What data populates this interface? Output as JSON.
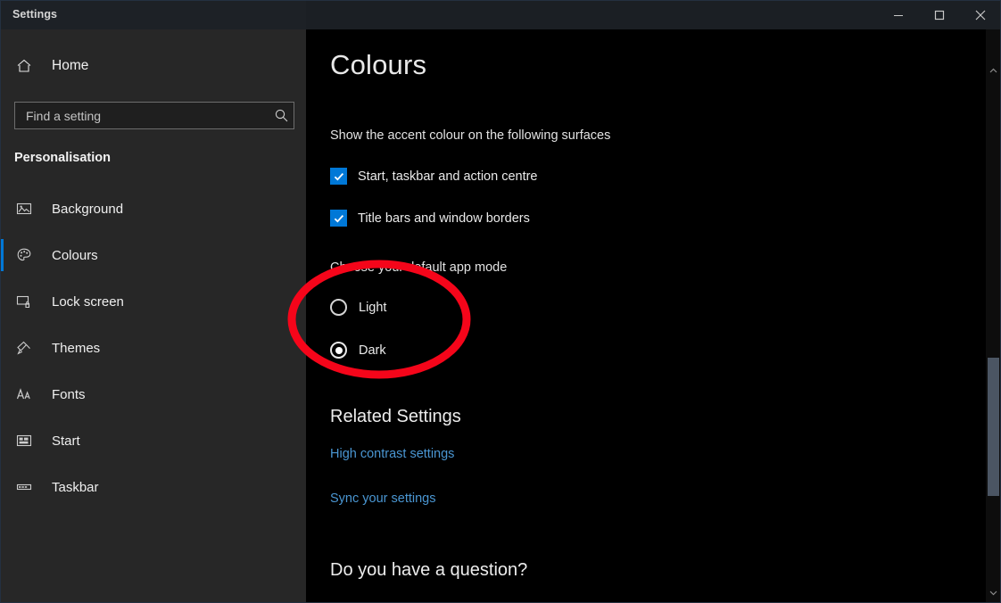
{
  "window": {
    "title": "Settings",
    "controls": [
      {
        "name": "minimize",
        "glyph": "minimize-icon",
        "label": "Minimise"
      },
      {
        "name": "maximize",
        "glyph": "maximize-icon",
        "label": "Maximise"
      },
      {
        "name": "close",
        "glyph": "close-icon",
        "label": "Close"
      }
    ]
  },
  "sidebar": {
    "home": {
      "label": "Home",
      "icon": "home-icon"
    },
    "search": {
      "placeholder": "Find a setting",
      "value": "",
      "icon": "search-icon"
    },
    "section_header": "Personalisation",
    "items": [
      {
        "label": "Background",
        "icon": "image-icon",
        "selected": false
      },
      {
        "label": "Colours",
        "icon": "palette-icon",
        "selected": true
      },
      {
        "label": "Lock screen",
        "icon": "lock-screen-icon",
        "selected": false
      },
      {
        "label": "Themes",
        "icon": "brush-icon",
        "selected": false
      },
      {
        "label": "Fonts",
        "icon": "font-icon",
        "selected": false
      },
      {
        "label": "Start",
        "icon": "start-grid-icon",
        "selected": false
      },
      {
        "label": "Taskbar",
        "icon": "taskbar-icon",
        "selected": false
      }
    ]
  },
  "main": {
    "page_title": "Colours",
    "accent_subhead": "Show the accent colour on the following surfaces",
    "checkboxes": [
      {
        "label": "Start, taskbar and action centre",
        "checked": true
      },
      {
        "label": "Title bars and window borders",
        "checked": true
      }
    ],
    "app_mode": {
      "heading": "Choose your default app mode",
      "options": [
        {
          "label": "Light",
          "selected": false
        },
        {
          "label": "Dark",
          "selected": true
        }
      ]
    },
    "related": {
      "title": "Related Settings",
      "links": [
        {
          "label": "High contrast settings"
        },
        {
          "label": "Sync your settings"
        }
      ]
    },
    "question": {
      "title": "Do you have a question?"
    }
  },
  "scrollbar": {
    "up_arrow": "chevron-up-icon",
    "down_arrow": "chevron-down-icon"
  },
  "annotation": {
    "shape": "ellipse-highlight",
    "colour": "#f5051a"
  },
  "colours": {
    "accent": "#0078d7",
    "sidebar_bg": "#272727",
    "content_bg": "#000000",
    "link": "#4a96d2",
    "annotation": "#f5051a"
  }
}
